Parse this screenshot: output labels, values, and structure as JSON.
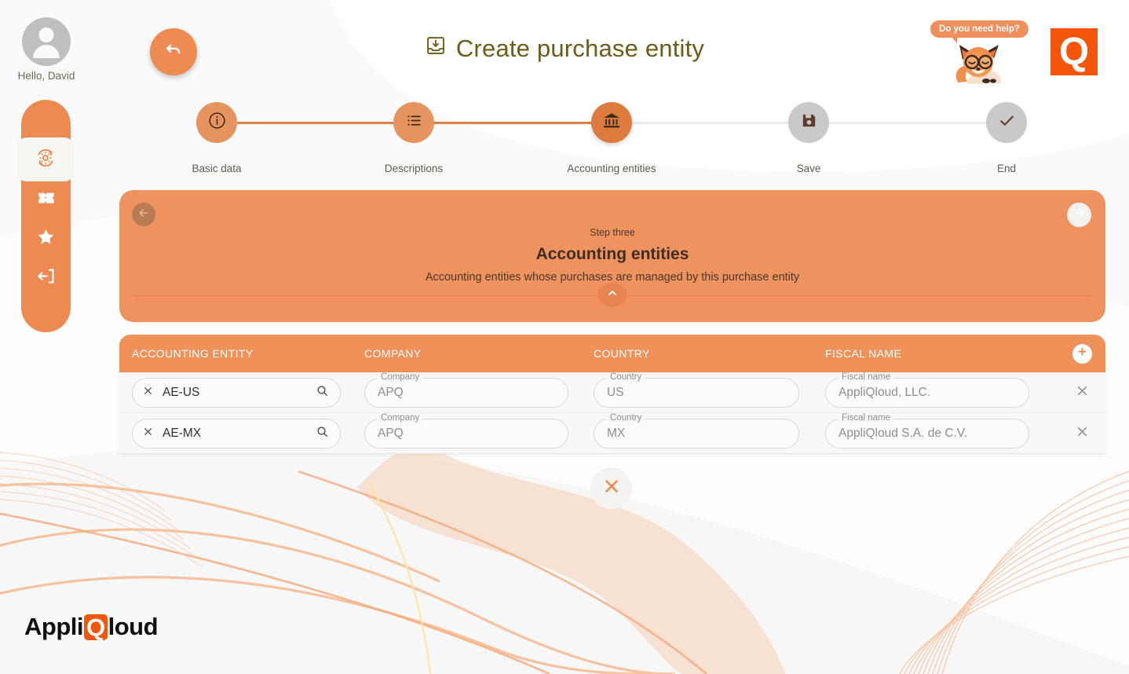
{
  "user": {
    "greeting": "Hello, David",
    "avatar_icon": "person-avatar-icon"
  },
  "sidebar": {
    "items": [
      {
        "id": "settings",
        "icon": "settings-gear-refresh-icon",
        "active": true
      },
      {
        "id": "tickets",
        "icon": "ticket-icon",
        "active": false
      },
      {
        "id": "favorites",
        "icon": "star-icon",
        "active": false
      },
      {
        "id": "logout",
        "icon": "logout-icon",
        "active": false
      }
    ]
  },
  "toolbar": {
    "undo_icon": "undo-arrow-icon"
  },
  "header": {
    "title": "Create purchase entity",
    "title_icon": "inbox-download-icon"
  },
  "help": {
    "bubble_text": "Do you need help?",
    "mascot_icon": "fox-mascot-icon"
  },
  "brand": {
    "logo_icon": "q-logo-icon",
    "logo_letter": "Q",
    "name_prefix": "Appli",
    "name_mark": "Q",
    "name_suffix": "loud"
  },
  "stepper": {
    "steps": [
      {
        "label": "Basic data",
        "icon": "info-circle-icon",
        "state": "done"
      },
      {
        "label": "Descriptions",
        "icon": "list-icon",
        "state": "done"
      },
      {
        "label": "Accounting entities",
        "icon": "bank-icon",
        "state": "current"
      },
      {
        "label": "Save",
        "icon": "floppy-save-icon",
        "state": "todo"
      },
      {
        "label": "End",
        "icon": "check-icon",
        "state": "todo"
      }
    ],
    "progress_percent": 50
  },
  "banner": {
    "back_icon": "arrow-left-icon",
    "next_icon": "arrow-right-icon",
    "step_eyebrow": "Step three",
    "heading": "Accounting entities",
    "subtitle": "Accounting entities whose purchases are managed by this purchase entity",
    "collapse_icon": "chevron-up-icon"
  },
  "table": {
    "columns": [
      {
        "key": "entity",
        "label": "ACCOUNTING ENTITY"
      },
      {
        "key": "company",
        "label": "COMPANY"
      },
      {
        "key": "country",
        "label": "COUNTRY"
      },
      {
        "key": "fiscal",
        "label": "FISCAL NAME"
      }
    ],
    "add_row_icon": "plus-circle-icon",
    "remove_row_icon": "close-x-icon",
    "clear_icon": "close-x-icon",
    "search_icon": "magnifier-icon",
    "field_labels": {
      "company": "Company",
      "country": "Country",
      "fiscal": "Fiscal name"
    },
    "rows": [
      {
        "entity": "AE-US",
        "company": "APQ",
        "country": "US",
        "fiscal": "AppliQloud, LLC."
      },
      {
        "entity": "AE-MX",
        "company": "APQ",
        "country": "MX",
        "fiscal": "AppliQloud S.A. de C.V."
      }
    ]
  },
  "footer_actions": {
    "close_icon": "close-x-icon"
  },
  "colors": {
    "accent_orange": "#ee9259",
    "brand_orange": "#f4550a",
    "step_current": "#dd7b3e",
    "step_done": "#e5935f",
    "step_todo": "#c9c9c9",
    "title_olive": "#6b5c17",
    "page_bg": "#fafafa"
  }
}
